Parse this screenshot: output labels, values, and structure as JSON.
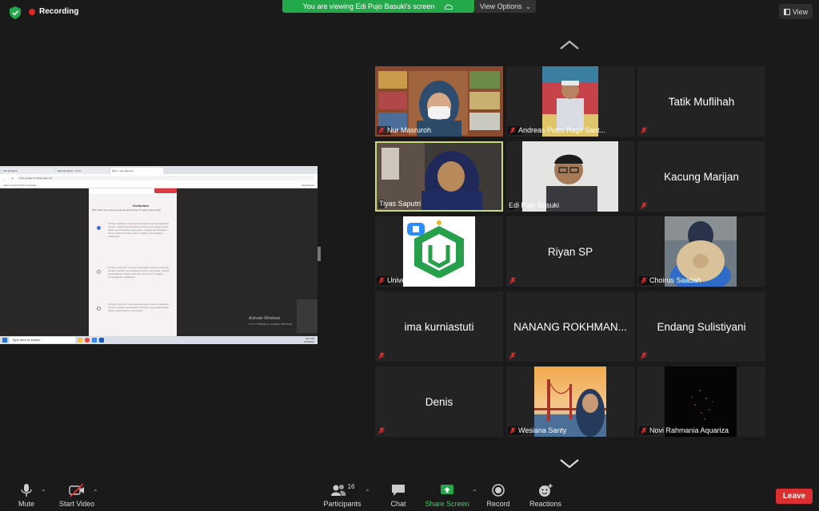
{
  "top": {
    "recording_label": "Recording",
    "viewing_banner": "You are viewing Edi Pujo Basuki's screen",
    "view_options_label": "View Options",
    "view_button_label": "View"
  },
  "shared_screen": {
    "tabs": [
      "KPI Windows",
      "Mati Wonderer - Zoom",
      "Meet - pjay-dfgu-oht"
    ],
    "url": "meet.google.com/pjay-dfgu-oht",
    "bookmarks": "Apps  Gmail  YouTube  Translate",
    "reading_list": "Reading list",
    "form_title": "Kurikulum",
    "form_question": "Pilih salah satu yang sesuai dengan Arahan Program Studi anda",
    "options": [
      "Struktur kurikulum memuat keterkaitan antara matakuliah dengan capaian pembelajaran lulusan yang digambarkan dalam peta kurikulum yang jelas, capaian pembelajaran lulusan dipenuhi oleh seluruh capaian pembelajaran matakuliah",
      "Struktur kurikulum memuat keterkaitan antara matakuliah dengan capaian pembelajaran lulusan yang jelas, capaian pembelajaran lulusan dipenuhi oleh seluruh capaian pembelajaran matakuliah",
      "Struktur kurikulum memuat keterkaitan antara matakuliah dengan capaian pembelajaran lulusan yang digambarkan dalam peta kurikulum yang jelas"
    ],
    "activate_windows": "Activate Windows",
    "activate_hint": "Go to Settings to activate Windows.",
    "taskbar_search": "Type here to search",
    "clock_time": "9:07 AM",
    "clock_date": "7/20/2021"
  },
  "participants": [
    {
      "name": "Nur Masruroh",
      "muted": true,
      "video": true
    },
    {
      "name": "Andreas Putro Ragil Sant...",
      "muted": true,
      "video": true
    },
    {
      "name": "Tatik Muflihah",
      "muted": true,
      "video": false
    },
    {
      "name": "Tiyas Saputri",
      "muted": false,
      "video": true,
      "active": true
    },
    {
      "name": "Edi Pujo Basuki",
      "muted": false,
      "video": true
    },
    {
      "name": "Kacung Marijan",
      "muted": true,
      "video": false
    },
    {
      "name": "Universitas NU Surabaya",
      "muted": true,
      "video": true
    },
    {
      "name": "Riyan SP",
      "muted": true,
      "video": false
    },
    {
      "name": "Choirus Saadah",
      "muted": true,
      "video": true
    },
    {
      "name": "ima kurniastuti",
      "muted": true,
      "video": false
    },
    {
      "name": "NANANG ROKHMAN...",
      "muted": true,
      "video": false
    },
    {
      "name": "Endang Sulistiyani",
      "muted": true,
      "video": false
    },
    {
      "name": "Denis",
      "muted": true,
      "video": false
    },
    {
      "name": "Wesiana Santy",
      "muted": true,
      "video": true
    },
    {
      "name": "Novi Rahmania Aquariza",
      "muted": true,
      "video": true
    }
  ],
  "toolbar": {
    "mute": "Mute",
    "start_video": "Start Video",
    "participants": "Participants",
    "participant_count": "16",
    "chat": "Chat",
    "share_screen": "Share Screen",
    "record": "Record",
    "reactions": "Reactions",
    "leave": "Leave"
  },
  "colors": {
    "green_banner": "#23a94a",
    "leave_red": "#dc3030",
    "active_speaker_border": "#c7dc79",
    "tile_bg": "#232323"
  }
}
